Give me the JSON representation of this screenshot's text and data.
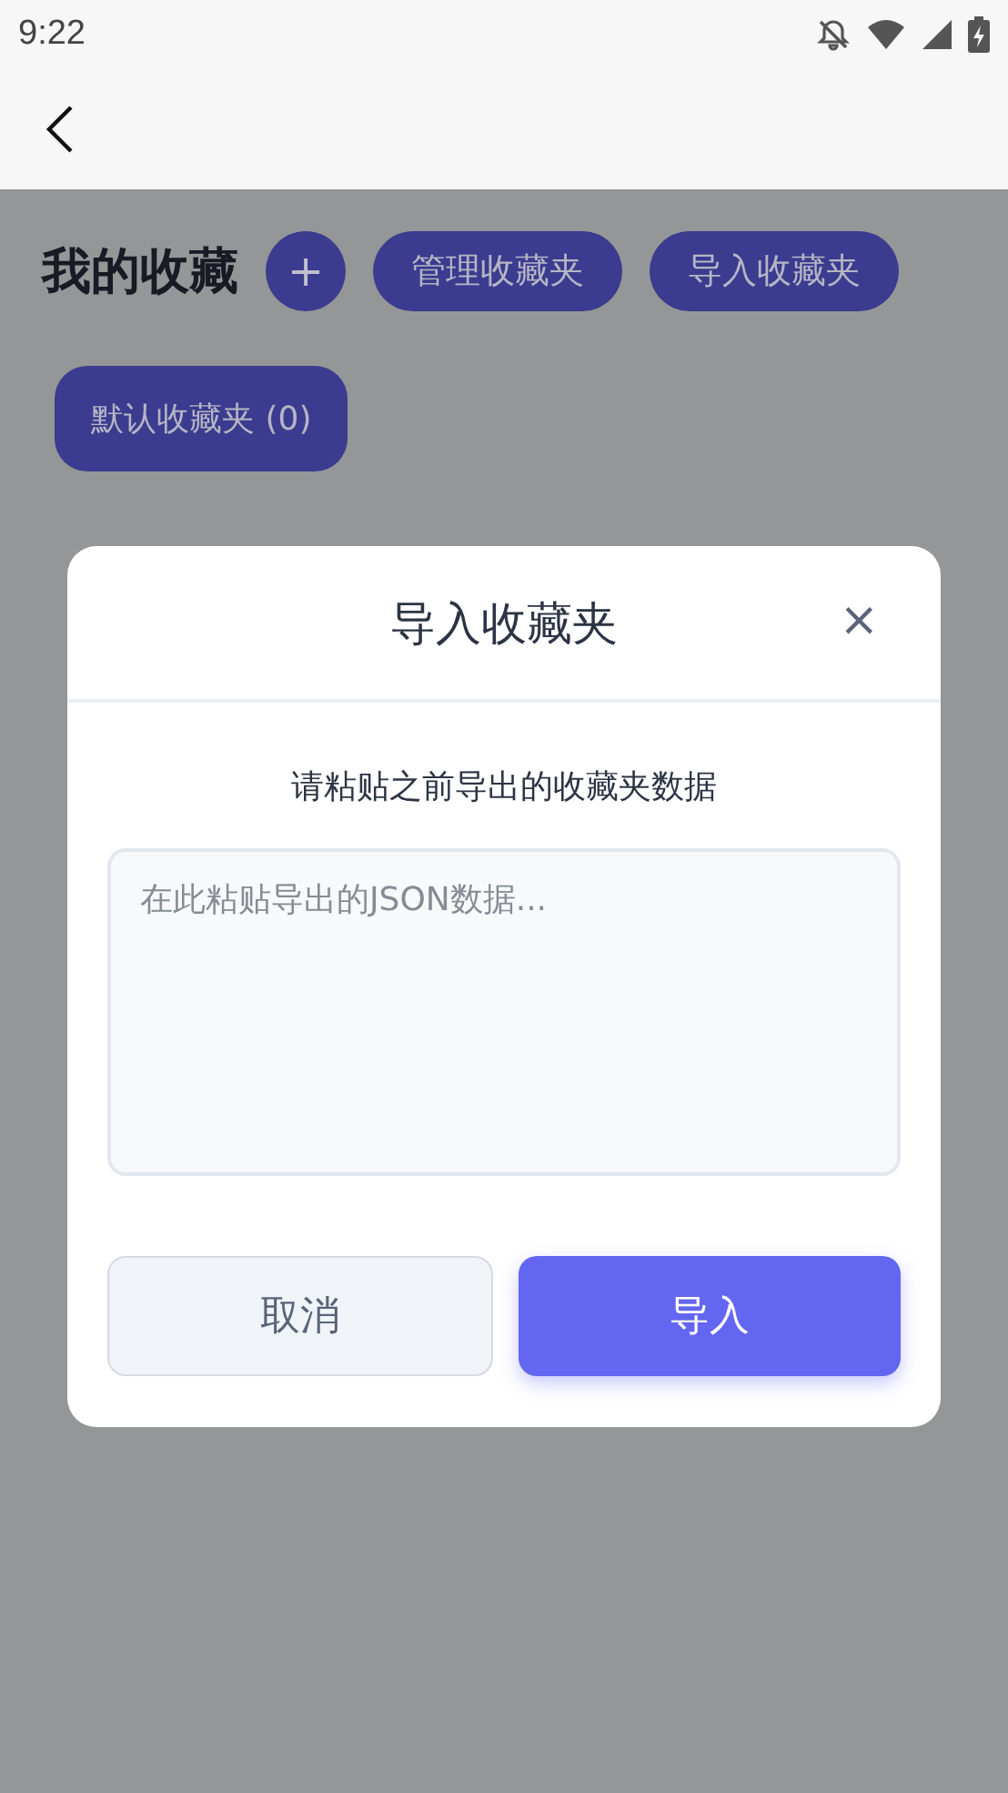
{
  "status_bar": {
    "time": "9:22"
  },
  "header": {
    "title": "我的收藏",
    "add_label": "+",
    "actions": [
      "管理收藏夹",
      "导入收藏夹"
    ]
  },
  "folders": [
    {
      "label": "默认收藏夹 (0)"
    }
  ],
  "dialog": {
    "title": "导入收藏夹",
    "close": "×",
    "description": "请粘贴之前导出的收藏夹数据",
    "input": {
      "placeholder": "在此粘贴导出的JSON数据..."
    },
    "buttons": [
      {
        "label": "取消",
        "kind": "secondary"
      },
      {
        "label": "导入",
        "kind": "primary"
      }
    ]
  }
}
